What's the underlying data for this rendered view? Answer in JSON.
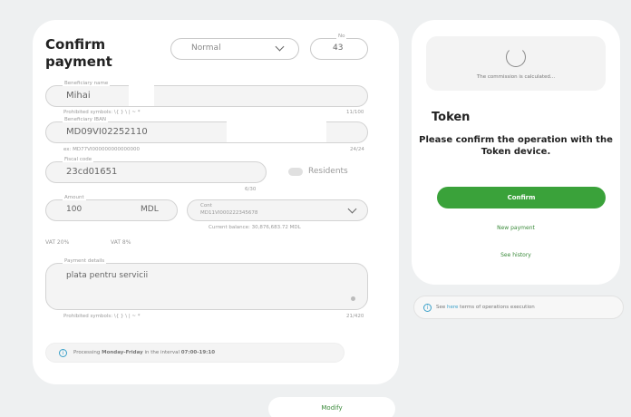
{
  "confirm": {
    "title_line1": "Confirm",
    "title_line2": "payment",
    "priority": "Normal",
    "no_label": "No",
    "no_value": "43",
    "beneficiary_name_label": "Beneficiary name",
    "beneficiary_name": "Mihai",
    "beneficiary_name_hint": "Prohibited symbols: \\{ } \\ | ~ *",
    "beneficiary_name_count": "11/100",
    "beneficiary_iban_label": "Beneficiary IBAN",
    "beneficiary_iban": "MD09VI02252110",
    "beneficiary_iban_hint": "ex: MD77VI000000000000000",
    "beneficiary_iban_count": "24/24",
    "fiscal_code_label": "Fiscal code",
    "fiscal_code": "23cd01651",
    "fiscal_code_count": "6/30",
    "residents_label": "Residents",
    "amount_label": "Amount",
    "amount": "100",
    "currency": "MDL",
    "account_label": "Cont",
    "account_number": "MD11VI000222345678",
    "current_balance": "Current balance: 30,876,683.72 MDL",
    "vat_20": "VAT 20%",
    "vat_8": "VAT 8%",
    "payment_details_label": "Payment details",
    "payment_details": "plata pentru servicii",
    "details_hint": "Prohibited symbols: \\{ } \\ | ~ *",
    "details_count": "21/420",
    "processing_prefix": "Processing",
    "processing_days": "Monday-Friday",
    "processing_middle": "in the interval",
    "processing_hours": "07:00-19:10",
    "modify_label": "Modify"
  },
  "token": {
    "commission_text": "The commission is calculated...",
    "title": "Token",
    "message": "Please confirm the operation with the Token device.",
    "confirm_label": "Confirm",
    "new_payment_label": "New payment",
    "see_history_label": "See history"
  },
  "terms": {
    "prefix": "See",
    "link": "here",
    "suffix": "terms of operations execution"
  },
  "colors": {
    "accent_green": "#3aa23a",
    "info_blue": "#3aa0c9"
  }
}
